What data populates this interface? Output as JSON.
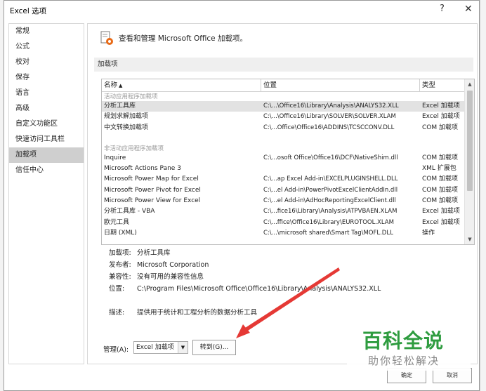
{
  "window": {
    "title": "Excel 选项",
    "help": "?",
    "close": "✕"
  },
  "sidebar": {
    "items": [
      {
        "label": "常规"
      },
      {
        "label": "公式"
      },
      {
        "label": "校对"
      },
      {
        "label": "保存"
      },
      {
        "label": "语言"
      },
      {
        "label": "高级"
      },
      {
        "label": "自定义功能区"
      },
      {
        "label": "快速访问工具栏"
      },
      {
        "label": "加载项"
      },
      {
        "label": "信任中心"
      }
    ],
    "active_index": 8
  },
  "main": {
    "header": "查看和管理 Microsoft Office 加载项。",
    "section": "加载项",
    "columns": {
      "name": "名称",
      "location": "位置",
      "type": "类型"
    },
    "groups": [
      {
        "title": "活动应用程序加载项",
        "rows": [
          {
            "name": "分析工具库",
            "location": "C:\\...\\Office16\\Library\\Analysis\\ANALYS32.XLL",
            "type": "Excel 加载项"
          },
          {
            "name": "规划求解加载项",
            "location": "C:\\...\\Office16\\Library\\SOLVER\\SOLVER.XLAM",
            "type": "Excel 加载项"
          },
          {
            "name": "中文转换加载项",
            "location": "C:\\...Office\\Office16\\ADDINS\\TCSCCONV.DLL",
            "type": "COM 加载项"
          }
        ]
      },
      {
        "title": "非活动应用程序加载项",
        "rows": [
          {
            "name": "Inquire",
            "location": "C:\\...osoft Office\\Office16\\DCF\\NativeShim.dll",
            "type": "COM 加载项"
          },
          {
            "name": "Microsoft Actions Pane 3",
            "location": "",
            "type": "XML 扩展包"
          },
          {
            "name": "Microsoft Power Map for Excel",
            "location": "C:\\...ap Excel Add-in\\EXCELPLUGINSHELL.DLL",
            "type": "COM 加载项"
          },
          {
            "name": "Microsoft Power Pivot for Excel",
            "location": "C:\\...el Add-in\\PowerPivotExcelClientAddIn.dll",
            "type": "COM 加载项"
          },
          {
            "name": "Microsoft Power View for Excel",
            "location": "C:\\...el Add-in\\AdHocReportingExcelClient.dll",
            "type": "COM 加载项"
          },
          {
            "name": "分析工具库 - VBA",
            "location": "C:\\...fice16\\Library\\Analysis\\ATPVBAEN.XLAM",
            "type": "Excel 加载项"
          },
          {
            "name": "欧元工具",
            "location": "C:\\...ffice\\Office16\\Library\\EUROTOOL.XLAM",
            "type": "Excel 加载项"
          },
          {
            "name": "日期 (XML)",
            "location": "C:\\...\\microsoft shared\\Smart Tag\\MOFL.DLL",
            "type": "操作"
          }
        ]
      }
    ],
    "details": {
      "addin_label": "加载项:",
      "addin_value": "分析工具库",
      "publisher_label": "发布者:",
      "publisher_value": "Microsoft Corporation",
      "compat_label": "兼容性:",
      "compat_value": "没有可用的兼容性信息",
      "location_label": "位置:",
      "location_value": "C:\\Program Files\\Microsoft Office\\Office16\\Library\\Analysis\\ANALYS32.XLL",
      "desc_label": "描述:",
      "desc_value": "提供用于统计和工程分析的数据分析工具"
    },
    "manage": {
      "label": "管理(A):",
      "selected": "Excel 加载项",
      "go_label": "转到(G)..."
    }
  },
  "footer": {
    "ok_label": "确定",
    "cancel_label": "取消"
  },
  "watermark": {
    "main": "百科全说",
    "sub": "助你轻松解决"
  },
  "colors": {
    "arrow": "#e53935",
    "watermark_green": "#2e9c3f",
    "selection": "#e2e2e2",
    "nav_active": "#cfcfcf"
  }
}
